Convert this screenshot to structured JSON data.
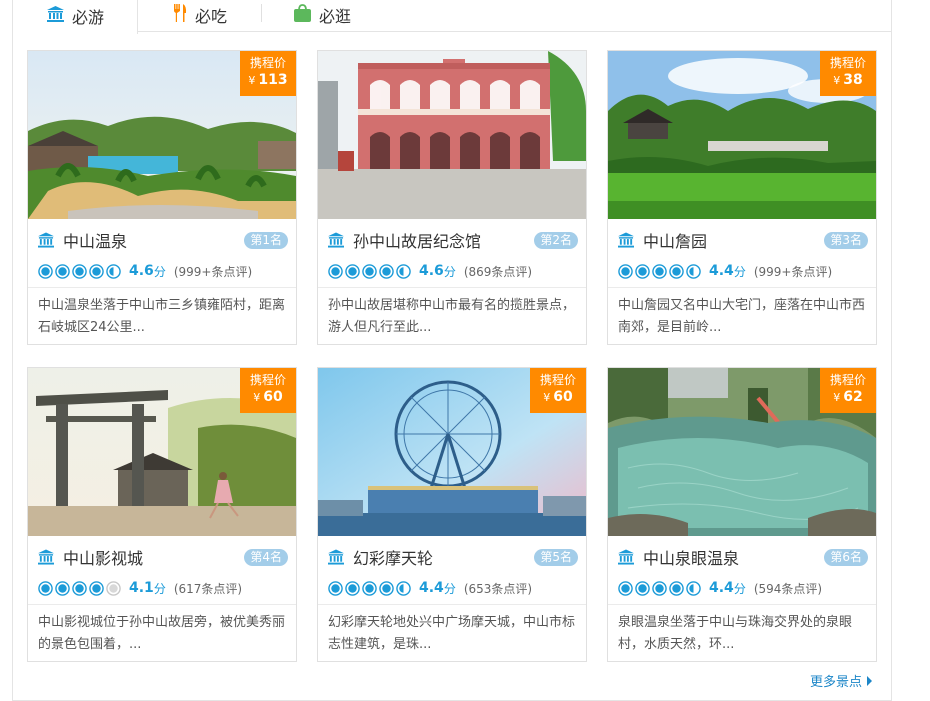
{
  "tabs": [
    {
      "label": "必游",
      "icon": "museum-icon",
      "color": "#1c9bd8"
    },
    {
      "label": "必吃",
      "icon": "fork-knife-icon",
      "color": "#ff8a00"
    },
    {
      "label": "必逛",
      "icon": "shopping-bag-icon",
      "color": "#5cb85c"
    }
  ],
  "cards": [
    {
      "name": "中山温泉",
      "rank": "第1名",
      "price_label": "携程价",
      "currency": "¥",
      "price": "113",
      "score": "4.6",
      "score_unit": "分",
      "reviews": "(999+条点评)",
      "desc": "中山温泉坐落于中山市三乡镇雍陌村，距离石岐城区24公里...",
      "filled_dots": 4.5
    },
    {
      "name": "孙中山故居纪念馆",
      "rank": "第2名",
      "price_label": "",
      "currency": "",
      "price": "",
      "score": "4.6",
      "score_unit": "分",
      "reviews": "(869条点评)",
      "desc": "孙中山故居堪称中山市最有名的揽胜景点，游人但凡行至此...",
      "filled_dots": 4.5
    },
    {
      "name": "中山詹园",
      "rank": "第3名",
      "price_label": "携程价",
      "currency": "¥",
      "price": "38",
      "score": "4.4",
      "score_unit": "分",
      "reviews": "(999+条点评)",
      "desc": "中山詹园又名中山大宅门，座落在中山市西南郊，是目前岭...",
      "filled_dots": 4.5
    },
    {
      "name": "中山影视城",
      "rank": "第4名",
      "price_label": "携程价",
      "currency": "¥",
      "price": "60",
      "score": "4.1",
      "score_unit": "分",
      "reviews": "(617条点评)",
      "desc": "中山影视城位于孙中山故居旁，被优美秀丽的景色包围着，...",
      "filled_dots": 4
    },
    {
      "name": "幻彩摩天轮",
      "rank": "第5名",
      "price_label": "携程价",
      "currency": "¥",
      "price": "60",
      "score": "4.4",
      "score_unit": "分",
      "reviews": "(653条点评)",
      "desc": "幻彩摩天轮地处兴中广场摩天城，中山市标志性建筑，是珠...",
      "filled_dots": 4.5
    },
    {
      "name": "中山泉眼温泉",
      "rank": "第6名",
      "price_label": "携程价",
      "currency": "¥",
      "price": "62",
      "score": "4.4",
      "score_unit": "分",
      "reviews": "(594条点评)",
      "desc": "泉眼温泉坐落于中山与珠海交界处的泉眼村，水质天然，环...",
      "filled_dots": 4.5
    }
  ],
  "more_link": "更多景点",
  "colors": {
    "accent": "#1c9bd8",
    "price_tag": "#ff8a00",
    "rank_badge": "#a3cde9"
  }
}
